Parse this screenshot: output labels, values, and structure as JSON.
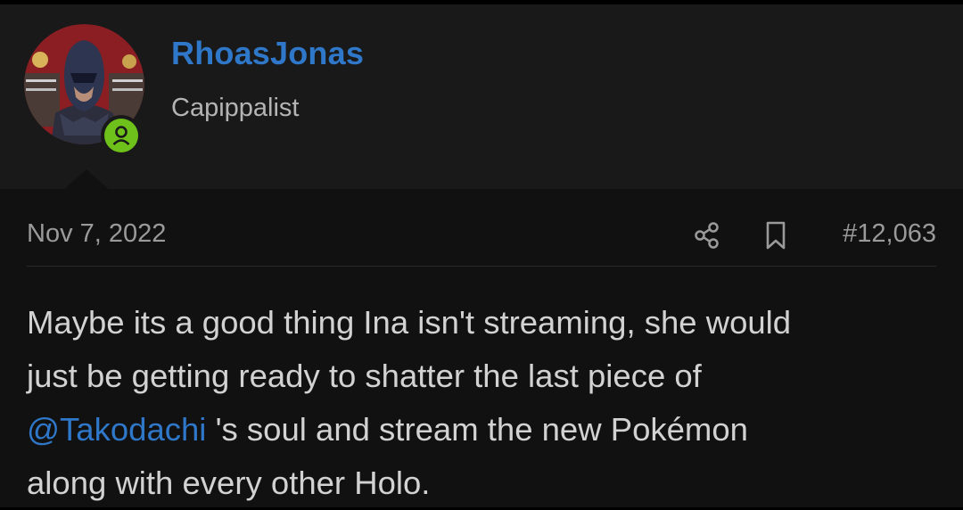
{
  "post": {
    "author": {
      "username": "RhoasJonas",
      "title": "Capippalist",
      "avatar_icon": "user-avatar",
      "status_icon": "online-user-icon",
      "status_color": "#6ec01a"
    },
    "date": "Nov 7, 2022",
    "actions": {
      "share_icon": "share-icon",
      "bookmark_icon": "bookmark-icon"
    },
    "number": "#12,063",
    "message": {
      "line1": "Maybe its a good thing Ina isn't streaming, she would",
      "line2": "just be getting ready to shatter the last piece of",
      "mention": "@Takodachi",
      "line3_rest": " 's soul and stream the new Pokémon",
      "line4": "along with every other Holo."
    }
  },
  "colors": {
    "link": "#2f77c8",
    "header_bg": "#191919",
    "body_bg": "#111111",
    "text": "#d2d2d2",
    "muted": "#9a9a9a"
  }
}
